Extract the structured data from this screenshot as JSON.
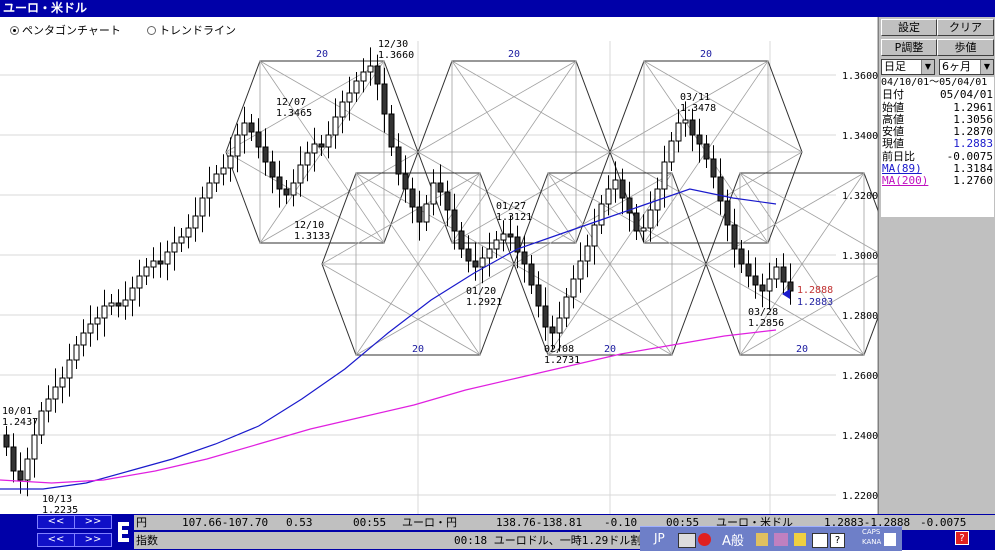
{
  "window": {
    "title": "ユーロ・米ドル"
  },
  "modes": [
    {
      "label": "ペンタゴンチャート",
      "selected": true
    },
    {
      "label": "トレンドライン",
      "selected": false
    }
  ],
  "panel": {
    "buttons": [
      "設定",
      "クリア",
      "P調整",
      "歩値"
    ],
    "period_type": "日足",
    "period_range": "6ヶ月",
    "date_range": "04/10/01～05/04/01",
    "rows": [
      {
        "label": "日付",
        "value": "05/04/01"
      },
      {
        "label": "始値",
        "value": "1.2961"
      },
      {
        "label": "高値",
        "value": "1.3056"
      },
      {
        "label": "安値",
        "value": "1.2870"
      },
      {
        "label": "現値",
        "value": "1.2883"
      },
      {
        "label": "前日比",
        "value": "-0.0075"
      },
      {
        "label": "MA(89)",
        "value": "1.3184"
      },
      {
        "label": "MA(200)",
        "value": "1.2760"
      }
    ]
  },
  "chart_data": {
    "type": "candlestick",
    "ylim": [
      1.215,
      1.37
    ],
    "y_ticks": [
      "1.3600",
      "1.3400",
      "1.3200",
      "1.3000",
      "1.2800",
      "1.2600",
      "1.2400",
      "1.2200"
    ],
    "y_tick_values": [
      1.36,
      1.34,
      1.32,
      1.3,
      1.28,
      1.26,
      1.24,
      1.22
    ],
    "pentagon_labels": [
      "20",
      "20",
      "20",
      "20",
      "20",
      "20"
    ],
    "annotations": [
      {
        "date": "10/01",
        "value": "1.2437"
      },
      {
        "date": "10/13",
        "value": "1.2235"
      },
      {
        "date": "12/07",
        "value": "1.3465"
      },
      {
        "date": "12/10",
        "value": "1.3133"
      },
      {
        "date": "12/30",
        "value": "1.3660"
      },
      {
        "date": "01/20",
        "value": "1.2921"
      },
      {
        "date": "01/27",
        "value": "1.3121"
      },
      {
        "date": "02/08",
        "value": "1.2731"
      },
      {
        "date": "03/11",
        "value": "1.3478"
      },
      {
        "date": "03/28",
        "value": "1.2856"
      }
    ],
    "markers": [
      {
        "label": "1.2888",
        "value": 1.2888,
        "color": "#c03030"
      },
      {
        "label": "1.2883",
        "value": 1.2883,
        "color": "#2020a0"
      }
    ],
    "series": [
      {
        "name": "MA(89)",
        "color": "#1a1acc",
        "values": [
          1.222,
          1.222,
          1.224,
          1.228,
          1.232,
          1.237,
          1.243,
          1.252,
          1.262,
          1.274,
          1.285,
          1.294,
          1.302,
          1.307,
          1.312,
          1.317,
          1.322,
          1.319,
          1.317
        ]
      },
      {
        "name": "MA(200)",
        "color": "#e020e0",
        "values": [
          1.225,
          1.224,
          1.225,
          1.228,
          1.232,
          1.237,
          1.242,
          1.246,
          1.25,
          1.255,
          1.259,
          1.263,
          1.267,
          1.27,
          1.273,
          1.275
        ]
      },
      {
        "name": "price",
        "values": [
          1.236,
          1.228,
          1.225,
          1.232,
          1.24,
          1.248,
          1.252,
          1.256,
          1.259,
          1.265,
          1.27,
          1.274,
          1.277,
          1.279,
          1.283,
          1.284,
          1.283,
          1.285,
          1.289,
          1.293,
          1.296,
          1.298,
          1.297,
          1.301,
          1.304,
          1.306,
          1.309,
          1.313,
          1.319,
          1.324,
          1.327,
          1.329,
          1.333,
          1.34,
          1.344,
          1.341,
          1.336,
          1.331,
          1.326,
          1.322,
          1.32,
          1.324,
          1.33,
          1.334,
          1.337,
          1.336,
          1.34,
          1.346,
          1.351,
          1.354,
          1.358,
          1.361,
          1.363,
          1.357,
          1.347,
          1.336,
          1.327,
          1.322,
          1.316,
          1.311,
          1.317,
          1.324,
          1.321,
          1.315,
          1.308,
          1.302,
          1.298,
          1.296,
          1.299,
          1.302,
          1.305,
          1.307,
          1.306,
          1.301,
          1.297,
          1.29,
          1.283,
          1.276,
          1.274,
          1.279,
          1.286,
          1.292,
          1.298,
          1.303,
          1.31,
          1.317,
          1.322,
          1.325,
          1.319,
          1.314,
          1.308,
          1.309,
          1.315,
          1.322,
          1.331,
          1.338,
          1.344,
          1.345,
          1.34,
          1.337,
          1.332,
          1.326,
          1.318,
          1.31,
          1.302,
          1.297,
          1.293,
          1.29,
          1.288,
          1.292,
          1.296,
          1.291,
          1.288
        ]
      }
    ]
  },
  "ticker": {
    "row1_label": "円",
    "row1_items": [
      "107.66-107.70",
      "0.53",
      "00:55",
      "ユーロ・円",
      "138.76-138.81",
      "-0.10",
      "00:55",
      "ユーロ・米ドル",
      "1.2883-1.2888",
      "-0.0075"
    ],
    "row2_label": "指数",
    "news_time": "00:18",
    "news_text": "ユーロドル、一時1.29ドル割",
    "nav_prev": "<<",
    "nav_next": ">>"
  },
  "tray": {
    "lang": "JP",
    "ime": "A般",
    "caps": "CAPS",
    "kana": "KANA"
  }
}
